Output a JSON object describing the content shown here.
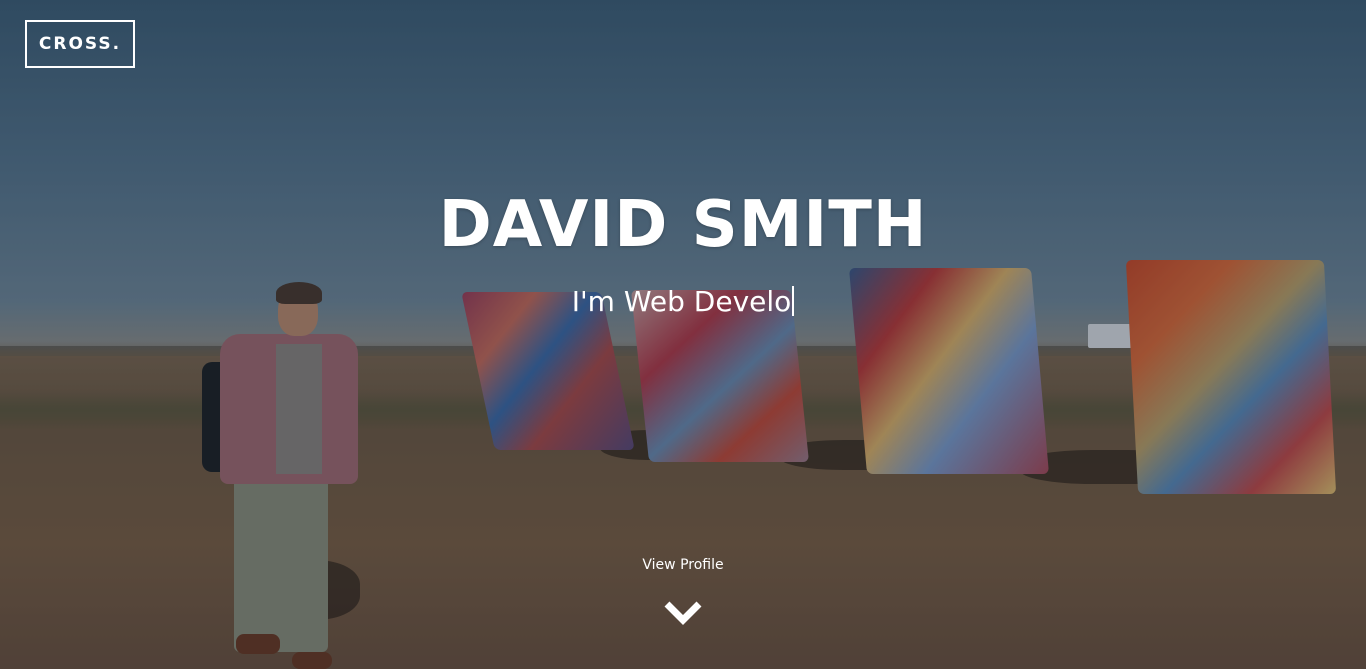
{
  "brand": {
    "logo_text": "CROSS."
  },
  "hero": {
    "title": "DAVID SMITH",
    "subtitle_typed": "I'm Web Develo"
  },
  "scroll_cta": {
    "label": "View Profile",
    "icon": "chevron-down-icon"
  },
  "colors": {
    "text": "#ffffff",
    "sky": "#4a6a84",
    "ground": "#7a5f45"
  }
}
